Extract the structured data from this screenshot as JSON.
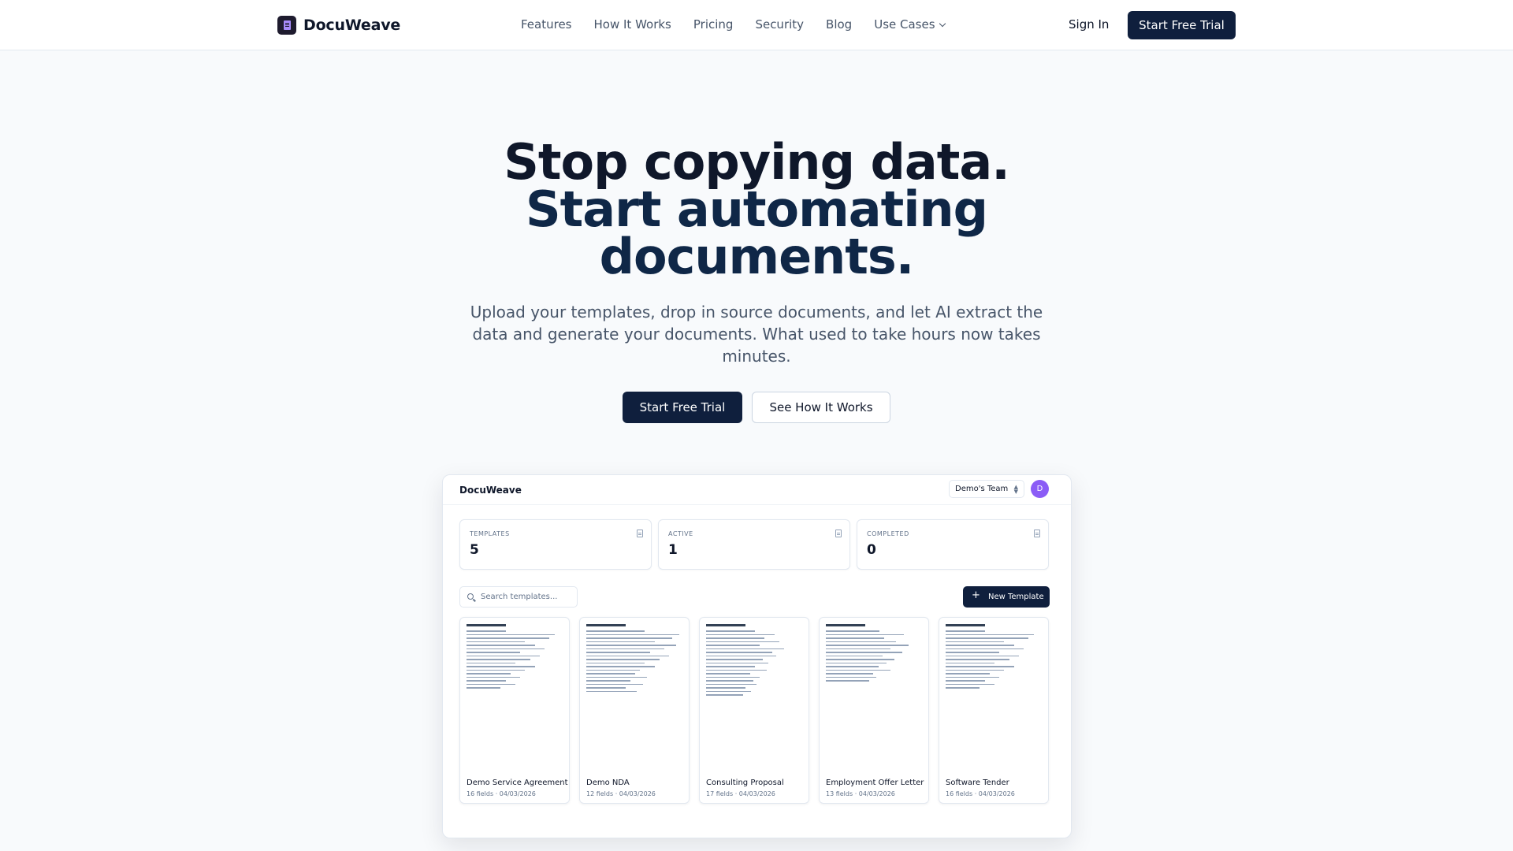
{
  "nav": {
    "brand": "DocuWeave",
    "links": [
      "Features",
      "How It Works",
      "Pricing",
      "Security",
      "Blog",
      "Use Cases"
    ],
    "sign_in": "Sign In",
    "cta": "Start Free Trial"
  },
  "hero": {
    "title_line1": "Stop copying data.",
    "title_line2": "Start automating documents.",
    "subtitle": "Upload your templates, drop in source documents, and let AI extract the data and generate your documents. What used to take hours now takes minutes.",
    "primary_button": "Start Free Trial",
    "secondary_button": "See How It Works"
  },
  "preview": {
    "brand": "DocuWeave",
    "team": "Demo's Team",
    "avatar_initial": "D",
    "stats": [
      {
        "label": "TEMPLATES",
        "value": "5"
      },
      {
        "label": "ACTIVE",
        "value": "1"
      },
      {
        "label": "COMPLETED",
        "value": "0"
      }
    ],
    "search_placeholder": "Search templates...",
    "new_template": "New Template",
    "templates": [
      {
        "name": "Demo Service Agreement",
        "meta": "16 fields · 04/03/2026"
      },
      {
        "name": "Demo NDA",
        "meta": "12 fields · 04/03/2026"
      },
      {
        "name": "Consulting Proposal",
        "meta": "17 fields · 04/03/2026"
      },
      {
        "name": "Employment Offer Letter",
        "meta": "13 fields · 04/03/2026"
      },
      {
        "name": "Software Tender",
        "meta": "16 fields · 04/03/2026"
      }
    ]
  },
  "colors": {
    "primary": "#0f1f3d",
    "avatar": "#8b5cf6",
    "background": "#f8fafc"
  }
}
